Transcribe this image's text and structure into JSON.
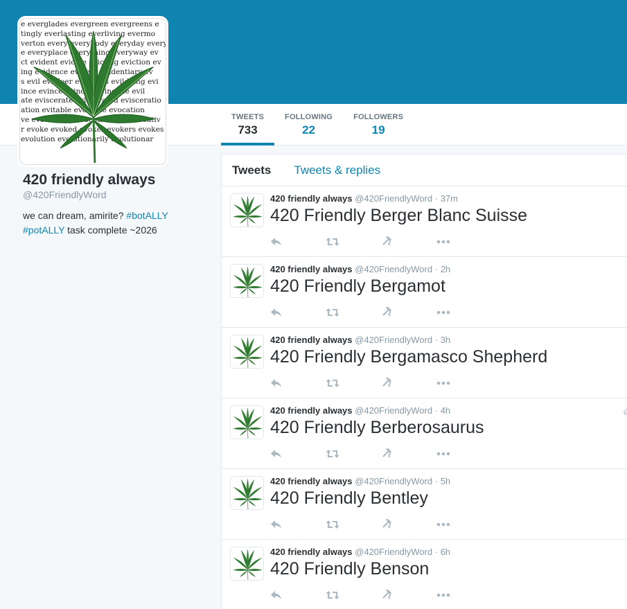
{
  "colors": {
    "brand": "#0f84b0",
    "text": "#292f33",
    "muted": "#8899a6",
    "leaf": "#2d7a2e"
  },
  "avatar": {
    "icon": "cannabis-leaf-icon",
    "text_lines": [
      "e everglades evergreen evergreens e",
      "tingly everlasting everliving evermo",
      "verton every everybody everyday every",
      "e everyplace everything everyway ev",
      "ct evident evictee evicting eviction ev",
      "ing evidence evident evidentiary ev",
      "s evil evildoer evildoers evildoing evi",
      "ince evince evinced evincible evil",
      "ate eviscerate eviscerated evisceratio",
      "ation evitable evocable evocation",
      "ve evocatively evocativeness evocativ",
      "r evoke evoked evoker evokers evokes",
      "evolution evolutionarily evolutionar"
    ]
  },
  "stats": [
    {
      "label": "TWEETS",
      "value": "733"
    },
    {
      "label": "FOLLOWING",
      "value": "22"
    },
    {
      "label": "FOLLOWERS",
      "value": "19"
    }
  ],
  "profile": {
    "name": "420 friendly always",
    "handle": "@420FriendlyWord",
    "bio_prefix": "we can dream, amirite? ",
    "bio_tag1": "#botALLY",
    "bio_tag2": "#potALLY",
    "bio_suffix": " task complete ~2026"
  },
  "timeline": {
    "tabs": [
      "Tweets",
      "Tweets & replies"
    ],
    "tweets": [
      {
        "name": "420 friendly always",
        "handle": "@420FriendlyWord",
        "sep": "·",
        "time": "37m",
        "text": "420 Friendly Berger Blanc Suisse"
      },
      {
        "name": "420 friendly always",
        "handle": "@420FriendlyWord",
        "sep": "·",
        "time": "2h",
        "text": "420 Friendly Bergamot"
      },
      {
        "name": "420 friendly always",
        "handle": "@420FriendlyWord",
        "sep": "·",
        "time": "3h",
        "text": "420 Friendly Bergamasco Shepherd"
      },
      {
        "name": "420 friendly always",
        "handle": "@420FriendlyWord",
        "sep": "·",
        "time": "4h",
        "text": "420 Friendly Berberosaurus"
      },
      {
        "name": "420 friendly always",
        "handle": "@420FriendlyWord",
        "sep": "·",
        "time": "5h",
        "text": "420 Friendly Bentley"
      },
      {
        "name": "420 friendly always",
        "handle": "@420FriendlyWord",
        "sep": "·",
        "time": "6h",
        "text": "420 Friendly Benson"
      }
    ],
    "action_icons": [
      "reply-icon",
      "retweet-icon",
      "hammer-sickle-icon",
      "more-icon"
    ],
    "globe_icon": "globe-icon"
  }
}
